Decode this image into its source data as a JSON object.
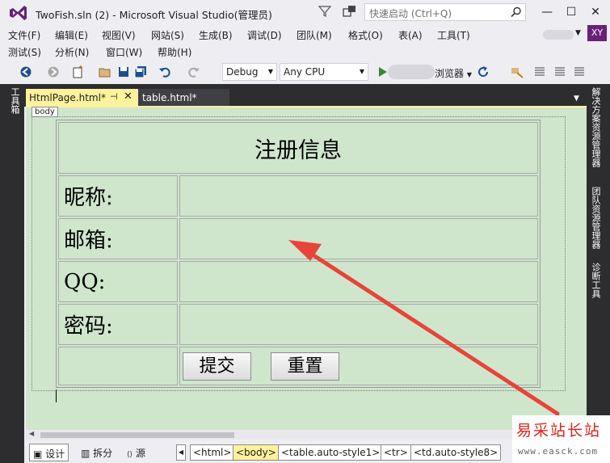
{
  "window": {
    "title": "TwoFish.sln (2) - Microsoft Visual Studio(管理员)",
    "quick_launch_placeholder": "快速启动 (Ctrl+Q)",
    "min_glyph": "—",
    "max_glyph": "☐",
    "close_glyph": "✕",
    "user_initials": "XY",
    "user_dropdown_glyph": "▼"
  },
  "menu": {
    "row1": [
      "文件(F)",
      "编辑(E)",
      "视图(V)",
      "网站(S)",
      "生成(B)",
      "调试(D)",
      "团队(M)",
      "格式(O)",
      "表(A)",
      "工具(T)"
    ],
    "row2": [
      "测试(S)",
      "分析(N)",
      "窗口(W)",
      "帮助(H)"
    ]
  },
  "toolbar": {
    "configuration": "Debug",
    "platform": "Any CPU",
    "browser_label": "浏览器",
    "dropdown_glyph": "▼"
  },
  "side_panels": {
    "left": "工具箱",
    "right": [
      "解决方案资源管理器",
      "团队资源管理器",
      "诊断工具"
    ]
  },
  "tabs": {
    "active_label": "HtmlPage.html*",
    "active_pin": "⊣",
    "active_close": "✕",
    "inactive_label": "table.html*",
    "overflow_glyph": "▼"
  },
  "design": {
    "body_tag": "body",
    "form_title": "注册信息",
    "fields": [
      "昵称:",
      "邮箱:",
      "QQ:",
      "密码:"
    ],
    "submit_label": "提交",
    "reset_label": "重置"
  },
  "bottom": {
    "view_design": "设计",
    "view_split": "拆分",
    "view_source": "源",
    "view_design_icon": "▣",
    "view_split_icon": "▥",
    "view_source_icon": "⟨⟩",
    "crumb_nav_left": "◀",
    "scroll_left": "◀",
    "breadcrumbs": [
      "<html>",
      "<body>",
      "<table.auto-style1>",
      "<tr>",
      "<td.auto-style8>"
    ]
  },
  "watermark": {
    "title": "易采站长站",
    "url": "www.easck.com"
  },
  "colors": {
    "vs_purple": "#68217A",
    "design_bg": "#CFE6CD",
    "active_tab": "#FFF29D",
    "dark_panel": "#2D2D30",
    "annotation_arrow": "#E8443A",
    "watermark_red": "#D9241C"
  }
}
